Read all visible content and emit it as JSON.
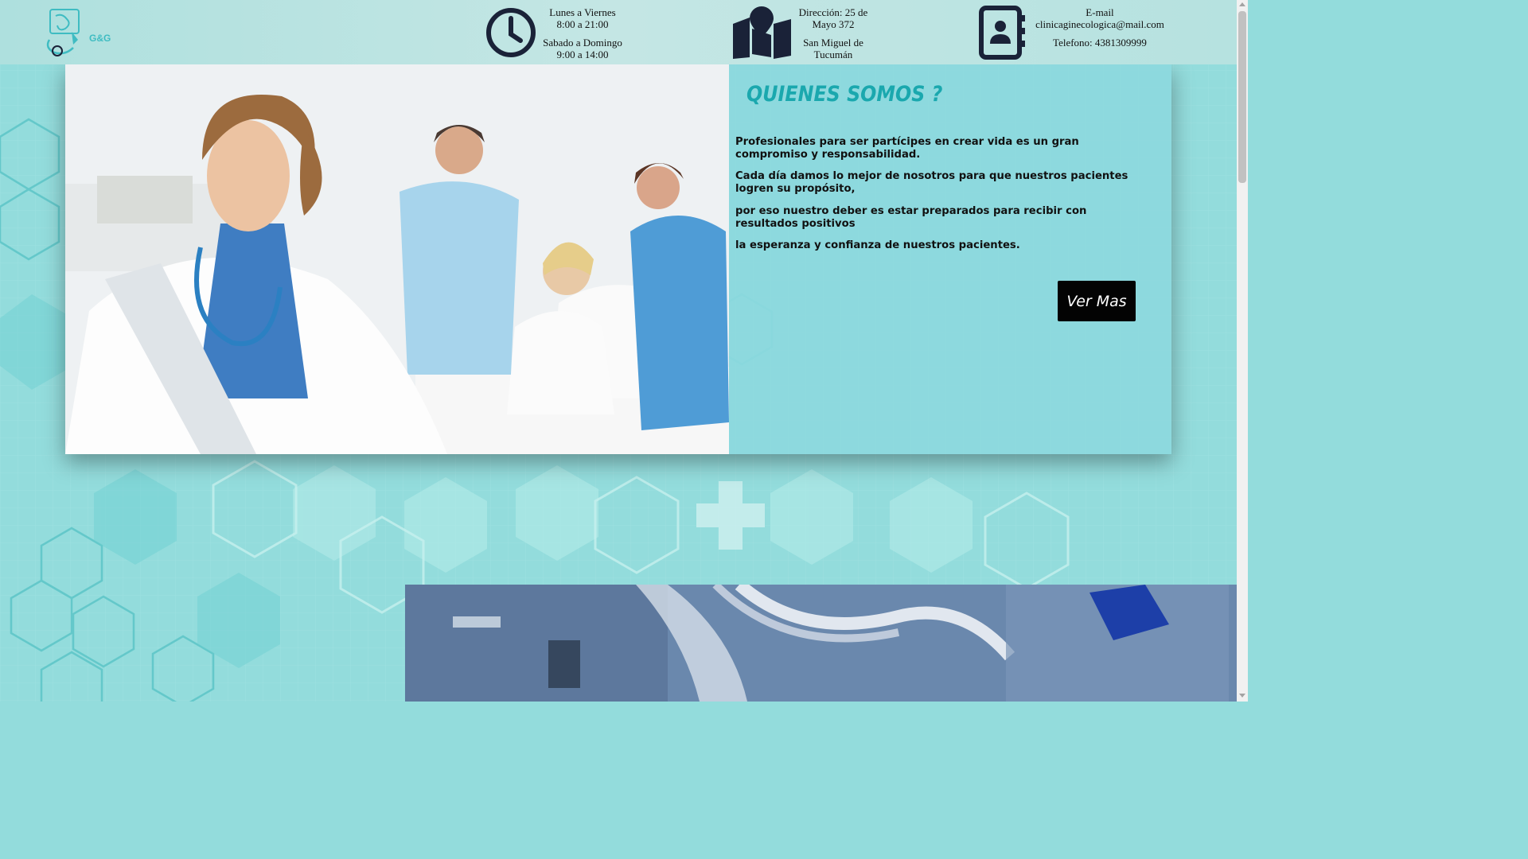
{
  "header": {
    "logo_text": "G&G",
    "hours": {
      "weekday_label": "Lunes a Viernes",
      "weekday_hours": "8:00 a 21:00",
      "weekend_label": "Sabado a Domingo",
      "weekend_hours": "9:00 a 14:00"
    },
    "address": {
      "line1": "Dirección: 25 de",
      "line2": "Mayo 372",
      "line3": "San Miguel de",
      "line4": "Tucumán"
    },
    "contact": {
      "email_label": "E-mail",
      "email": "clinicaginecologica@mail.com",
      "phone": "Telefono: 4381309999"
    },
    "icons": [
      "logo-icon",
      "clock-icon",
      "map-pin-icon",
      "contact-book-icon"
    ]
  },
  "about": {
    "title": "QUIENES SOMOS ?",
    "paragraphs": [
      "Profesionales para ser partícipes en crear vida es un gran compromiso y responsabilidad.",
      "Cada día damos lo mejor de nosotros para que nuestros pacientes logren su propósito,",
      "por eso nuestro deber es estar preparados para recibir con resultados positivos",
      "la esperanza y confianza de nuestros pacientes."
    ],
    "button_label": "Ver Mas"
  },
  "colors": {
    "accent": "#1aa8ae",
    "header_bg": "#c4e6e4",
    "page_bg": "#93dcdc",
    "icon_dark": "#1a2238",
    "button_bg": "#030303"
  }
}
